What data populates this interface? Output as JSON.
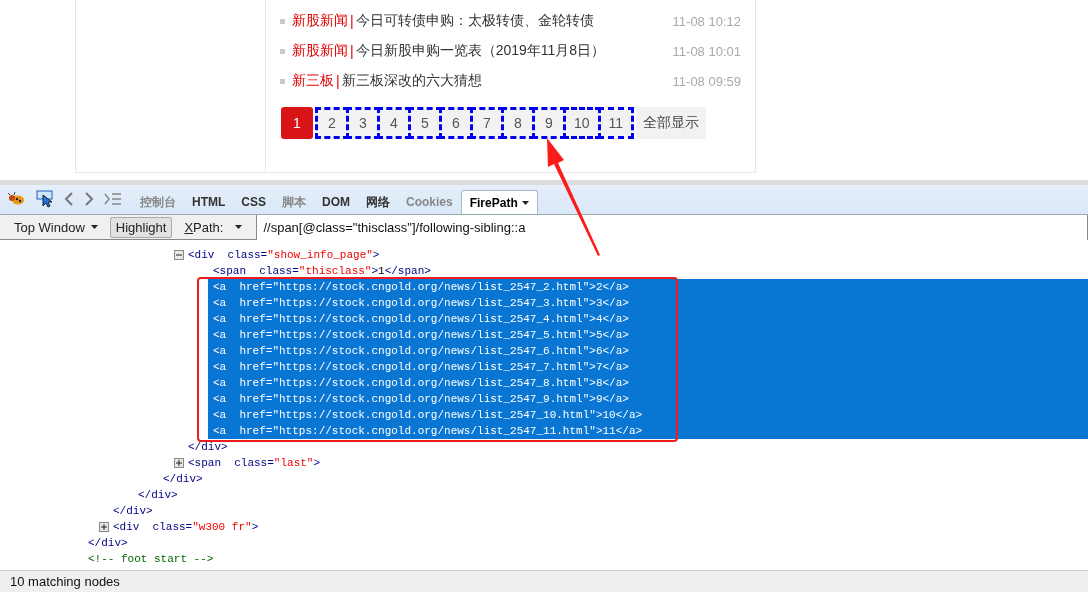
{
  "news": [
    {
      "category": "新股新闻",
      "divider": "|",
      "title": "今日可转债申购：太极转债、金轮转债",
      "time": "11-08 10:12"
    },
    {
      "category": "新股新闻",
      "divider": "|",
      "title": "今日新股申购一览表（2019年11月8日）",
      "time": "11-08 10:01"
    },
    {
      "category": "新三板",
      "divider": "|",
      "title": "新三板深改的六大猜想",
      "time": "11-08 09:59"
    }
  ],
  "pagination": {
    "pages": [
      {
        "label": "1",
        "selected": true,
        "highlighted": false
      },
      {
        "label": "2",
        "selected": false,
        "highlighted": true
      },
      {
        "label": "3",
        "selected": false,
        "highlighted": true
      },
      {
        "label": "4",
        "selected": false,
        "highlighted": true
      },
      {
        "label": "5",
        "selected": false,
        "highlighted": true
      },
      {
        "label": "6",
        "selected": false,
        "highlighted": true
      },
      {
        "label": "7",
        "selected": false,
        "highlighted": true
      },
      {
        "label": "8",
        "selected": false,
        "highlighted": true
      },
      {
        "label": "9",
        "selected": false,
        "highlighted": true
      },
      {
        "label": "10",
        "selected": false,
        "highlighted": true
      },
      {
        "label": "11",
        "selected": false,
        "highlighted": true
      }
    ],
    "show_all": "全部显示"
  },
  "devtools": {
    "tabs": [
      {
        "label": "控制台",
        "selected": false,
        "disabled": true
      },
      {
        "label": "HTML",
        "selected": false,
        "disabled": false
      },
      {
        "label": "CSS",
        "selected": false,
        "disabled": false
      },
      {
        "label": "脚本",
        "selected": false,
        "disabled": true
      },
      {
        "label": "DOM",
        "selected": false,
        "disabled": false
      },
      {
        "label": "网络",
        "selected": false,
        "disabled": false
      },
      {
        "label": "Cookies",
        "selected": false,
        "disabled": true
      },
      {
        "label": "FirePath",
        "selected": true,
        "disabled": false
      }
    ],
    "frame_select": "Top Window",
    "highlight": {
      "label": "Highlight",
      "on": true
    },
    "xpath_label": "XPath:",
    "xpath_value": "//span[@class=\"thisclass\"]/following-sibling::a"
  },
  "tree": [
    {
      "children": [
        {
          "children": [
            {
              "children": [
                {
                  "children": [
                    {
                      "open": [
                        {
                          "kind": "tag",
                          "text": "<div"
                        },
                        {
                          "kind": "attr",
                          "text": "class="
                        },
                        {
                          "kind": "value",
                          "text": "\"show_info_page\""
                        },
                        {
                          "kind": "tag",
                          "text": ">"
                        }
                      ],
                      "expanded": true,
                      "selected": false,
                      "children": [
                        {
                          "open": [
                            {
                              "kind": "tag",
                              "text": "<span"
                            },
                            {
                              "kind": "attr",
                              "text": "class="
                            },
                            {
                              "kind": "value",
                              "text": "\"thisclass\""
                            },
                            {
                              "kind": "tag",
                              "text": ">"
                            },
                            {
                              "kind": "text",
                              "text": "1"
                            },
                            {
                              "kind": "tag",
                              "text": "</span>"
                            }
                          ],
                          "selected": false
                        },
                        {
                          "open": [
                            {
                              "kind": "tag",
                              "text": "<a"
                            },
                            {
                              "kind": "attr",
                              "text": "href="
                            },
                            {
                              "kind": "value",
                              "text": "\"https://stock.cngold.org/news/list_2547_2.html\""
                            },
                            {
                              "kind": "tag",
                              "text": ">"
                            },
                            {
                              "kind": "text",
                              "text": "2"
                            },
                            {
                              "kind": "tag",
                              "text": "</a>"
                            }
                          ],
                          "selected": true
                        },
                        {
                          "open": [
                            {
                              "kind": "tag",
                              "text": "<a"
                            },
                            {
                              "kind": "attr",
                              "text": "href="
                            },
                            {
                              "kind": "value",
                              "text": "\"https://stock.cngold.org/news/list_2547_3.html\""
                            },
                            {
                              "kind": "tag",
                              "text": ">"
                            },
                            {
                              "kind": "text",
                              "text": "3"
                            },
                            {
                              "kind": "tag",
                              "text": "</a>"
                            }
                          ],
                          "selected": true
                        },
                        {
                          "open": [
                            {
                              "kind": "tag",
                              "text": "<a"
                            },
                            {
                              "kind": "attr",
                              "text": "href="
                            },
                            {
                              "kind": "value",
                              "text": "\"https://stock.cngold.org/news/list_2547_4.html\""
                            },
                            {
                              "kind": "tag",
                              "text": ">"
                            },
                            {
                              "kind": "text",
                              "text": "4"
                            },
                            {
                              "kind": "tag",
                              "text": "</a>"
                            }
                          ],
                          "selected": true
                        },
                        {
                          "open": [
                            {
                              "kind": "tag",
                              "text": "<a"
                            },
                            {
                              "kind": "attr",
                              "text": "href="
                            },
                            {
                              "kind": "value",
                              "text": "\"https://stock.cngold.org/news/list_2547_5.html\""
                            },
                            {
                              "kind": "tag",
                              "text": ">"
                            },
                            {
                              "kind": "text",
                              "text": "5"
                            },
                            {
                              "kind": "tag",
                              "text": "</a>"
                            }
                          ],
                          "selected": true
                        },
                        {
                          "open": [
                            {
                              "kind": "tag",
                              "text": "<a"
                            },
                            {
                              "kind": "attr",
                              "text": "href="
                            },
                            {
                              "kind": "value",
                              "text": "\"https://stock.cngold.org/news/list_2547_6.html\""
                            },
                            {
                              "kind": "tag",
                              "text": ">"
                            },
                            {
                              "kind": "text",
                              "text": "6"
                            },
                            {
                              "kind": "tag",
                              "text": "</a>"
                            }
                          ],
                          "selected": true
                        },
                        {
                          "open": [
                            {
                              "kind": "tag",
                              "text": "<a"
                            },
                            {
                              "kind": "attr",
                              "text": "href="
                            },
                            {
                              "kind": "value",
                              "text": "\"https://stock.cngold.org/news/list_2547_7.html\""
                            },
                            {
                              "kind": "tag",
                              "text": ">"
                            },
                            {
                              "kind": "text",
                              "text": "7"
                            },
                            {
                              "kind": "tag",
                              "text": "</a>"
                            }
                          ],
                          "selected": true
                        },
                        {
                          "open": [
                            {
                              "kind": "tag",
                              "text": "<a"
                            },
                            {
                              "kind": "attr",
                              "text": "href="
                            },
                            {
                              "kind": "value",
                              "text": "\"https://stock.cngold.org/news/list_2547_8.html\""
                            },
                            {
                              "kind": "tag",
                              "text": ">"
                            },
                            {
                              "kind": "text",
                              "text": "8"
                            },
                            {
                              "kind": "tag",
                              "text": "</a>"
                            }
                          ],
                          "selected": true
                        },
                        {
                          "open": [
                            {
                              "kind": "tag",
                              "text": "<a"
                            },
                            {
                              "kind": "attr",
                              "text": "href="
                            },
                            {
                              "kind": "value",
                              "text": "\"https://stock.cngold.org/news/list_2547_9.html\""
                            },
                            {
                              "kind": "tag",
                              "text": ">"
                            },
                            {
                              "kind": "text",
                              "text": "9"
                            },
                            {
                              "kind": "tag",
                              "text": "</a>"
                            }
                          ],
                          "selected": true
                        },
                        {
                          "open": [
                            {
                              "kind": "tag",
                              "text": "<a"
                            },
                            {
                              "kind": "attr",
                              "text": "href="
                            },
                            {
                              "kind": "value",
                              "text": "\"https://stock.cngold.org/news/list_2547_10.html\""
                            },
                            {
                              "kind": "tag",
                              "text": ">"
                            },
                            {
                              "kind": "text",
                              "text": "10"
                            },
                            {
                              "kind": "tag",
                              "text": "</a>"
                            }
                          ],
                          "selected": true
                        },
                        {
                          "open": [
                            {
                              "kind": "tag",
                              "text": "<a"
                            },
                            {
                              "kind": "attr",
                              "text": "href="
                            },
                            {
                              "kind": "value",
                              "text": "\"https://stock.cngold.org/news/list_2547_11.html\""
                            },
                            {
                              "kind": "tag",
                              "text": ">"
                            },
                            {
                              "kind": "text",
                              "text": "11"
                            },
                            {
                              "kind": "tag",
                              "text": "</a>"
                            }
                          ],
                          "selected": true
                        }
                      ],
                      "close": [
                        {
                          "kind": "tag",
                          "text": "</div>"
                        }
                      ]
                    },
                    {
                      "open": [
                        {
                          "kind": "tag",
                          "text": "<span"
                        },
                        {
                          "kind": "attr",
                          "text": "class="
                        },
                        {
                          "kind": "value",
                          "text": "\"last\""
                        },
                        {
                          "kind": "tag",
                          "text": ">"
                        }
                      ],
                      "expanded": false,
                      "selected": false
                    }
                  ],
                  "close": [
                    {
                      "kind": "tag",
                      "text": "</div>"
                    }
                  ]
                }
              ],
              "close": [
                {
                  "kind": "tag",
                  "text": "</div>"
                }
              ]
            }
          ],
          "close": [
            {
              "kind": "tag",
              "text": "</div>"
            }
          ]
        },
        {
          "open": [
            {
              "kind": "tag",
              "text": "<div"
            },
            {
              "kind": "attr",
              "text": "class="
            },
            {
              "kind": "value",
              "text": "\"w300 fr\""
            },
            {
              "kind": "tag",
              "text": ">"
            }
          ],
          "expanded": false,
          "selected": false
        }
      ],
      "close": [
        {
          "kind": "tag",
          "text": "</div>"
        }
      ]
    },
    {
      "open": [
        {
          "kind": "comment",
          "text": "<!-- foot start -->"
        }
      ],
      "selected": false
    }
  ],
  "status": "10 matching nodes"
}
